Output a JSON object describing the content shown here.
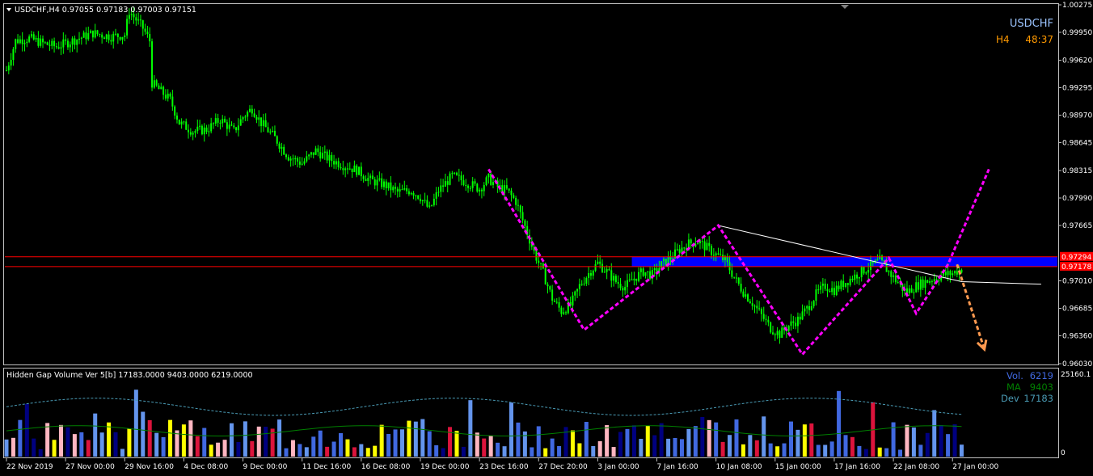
{
  "window": {
    "header_text": "USDCHF,H4  0.97055 0.97183 0.97003 0.97151",
    "symbol_label": "USDCHF",
    "timeframe_label": "H4",
    "countdown_label": "48:37"
  },
  "chart_data": {
    "type": "bar",
    "symbol": "USDCHF",
    "timeframe": "H4",
    "ohlc_last": {
      "open": 0.97055,
      "high": 0.97183,
      "low": 0.97003,
      "close": 0.97151
    },
    "ylim": [
      0.9603,
      1.00275
    ],
    "y_ticks": [
      "1.00275",
      "0.99950",
      "0.99620",
      "0.99295",
      "0.98970",
      "0.98645",
      "0.98315",
      "0.97990",
      "0.97665",
      "0.97010",
      "0.96685",
      "0.96360",
      "0.96030"
    ],
    "y_tick_values": [
      1.00275,
      0.9995,
      0.9962,
      0.99295,
      0.9897,
      0.98645,
      0.98315,
      0.9799,
      0.97665,
      0.9701,
      0.96685,
      0.9636,
      0.9603
    ],
    "price_labels": [
      "0.97294",
      "0.97178"
    ],
    "price_label_values": [
      0.97294,
      0.97178
    ],
    "x_ticks": [
      "22 Nov 2019",
      "27 Nov 00:00",
      "29 Nov 16:00",
      "4 Dec 08:00",
      "9 Dec 00:00",
      "11 Dec 16:00",
      "16 Dec 08:00",
      "19 Dec 00:00",
      "23 Dec 16:00",
      "27 Dec 20:00",
      "3 Jan 00:00",
      "7 Jan 16:00",
      "10 Jan 08:00",
      "15 Jan 00:00",
      "17 Jan 16:00",
      "22 Jan 08:00",
      "27 Jan 00:00"
    ],
    "x_tick_index": [
      0,
      26,
      52,
      78,
      104,
      130,
      156,
      182,
      208,
      234,
      260,
      286,
      312,
      338,
      364,
      390,
      416
    ],
    "bar_count": 421,
    "close_path": [
      [
        0,
        0.995
      ],
      [
        4,
        0.9985
      ],
      [
        10,
        0.9988
      ],
      [
        16,
        0.9982
      ],
      [
        22,
        0.9978
      ],
      [
        30,
        0.9986
      ],
      [
        38,
        0.9994
      ],
      [
        46,
        0.999
      ],
      [
        52,
        0.9992
      ],
      [
        54,
        1.002
      ],
      [
        60,
        1.0
      ],
      [
        63,
        0.9985
      ],
      [
        64,
        0.9935
      ],
      [
        68,
        0.9925
      ],
      [
        72,
        0.9915
      ],
      [
        76,
        0.9888
      ],
      [
        82,
        0.9878
      ],
      [
        88,
        0.988
      ],
      [
        94,
        0.9892
      ],
      [
        100,
        0.9878
      ],
      [
        104,
        0.9895
      ],
      [
        108,
        0.9905
      ],
      [
        112,
        0.9888
      ],
      [
        118,
        0.987
      ],
      [
        124,
        0.9848
      ],
      [
        130,
        0.984
      ],
      [
        136,
        0.9855
      ],
      [
        142,
        0.9845
      ],
      [
        148,
        0.9838
      ],
      [
        154,
        0.9832
      ],
      [
        160,
        0.982
      ],
      [
        166,
        0.9815
      ],
      [
        172,
        0.9806
      ],
      [
        178,
        0.9808
      ],
      [
        182,
        0.98
      ],
      [
        186,
        0.9785
      ],
      [
        190,
        0.9808
      ],
      [
        196,
        0.9825
      ],
      [
        202,
        0.9818
      ],
      [
        208,
        0.981
      ],
      [
        212,
        0.9822
      ],
      [
        216,
        0.9812
      ],
      [
        220,
        0.9808
      ],
      [
        224,
        0.9795
      ],
      [
        228,
        0.9765
      ],
      [
        232,
        0.9735
      ],
      [
        236,
        0.971
      ],
      [
        240,
        0.968
      ],
      [
        244,
        0.9665
      ],
      [
        248,
        0.9672
      ],
      [
        252,
        0.9695
      ],
      [
        256,
        0.971
      ],
      [
        260,
        0.9722
      ],
      [
        264,
        0.9712
      ],
      [
        268,
        0.97
      ],
      [
        272,
        0.9694
      ],
      [
        276,
        0.9704
      ],
      [
        280,
        0.9712
      ],
      [
        284,
        0.9708
      ],
      [
        288,
        0.972
      ],
      [
        292,
        0.9728
      ],
      [
        296,
        0.9738
      ],
      [
        300,
        0.9745
      ],
      [
        304,
        0.9748
      ],
      [
        308,
        0.974
      ],
      [
        312,
        0.9732
      ],
      [
        316,
        0.9725
      ],
      [
        320,
        0.9705
      ],
      [
        324,
        0.9688
      ],
      [
        328,
        0.9675
      ],
      [
        332,
        0.966
      ],
      [
        336,
        0.9645
      ],
      [
        340,
        0.9638
      ],
      [
        344,
        0.9648
      ],
      [
        348,
        0.9655
      ],
      [
        352,
        0.9668
      ],
      [
        356,
        0.9685
      ],
      [
        360,
        0.9695
      ],
      [
        364,
        0.969
      ],
      [
        368,
        0.9698
      ],
      [
        372,
        0.9705
      ],
      [
        376,
        0.9712
      ],
      [
        380,
        0.9718
      ],
      [
        384,
        0.9725
      ],
      [
        386,
        0.9718
      ],
      [
        390,
        0.9705
      ],
      [
        394,
        0.9692
      ],
      [
        396,
        0.9688
      ],
      [
        400,
        0.9695
      ],
      [
        404,
        0.97
      ],
      [
        408,
        0.9704
      ],
      [
        412,
        0.9708
      ],
      [
        416,
        0.971
      ],
      [
        420,
        0.97151
      ]
    ],
    "horizontal_lines": [
      0.97294,
      0.97178
    ],
    "zone": {
      "x_start": 275,
      "x_end": 420,
      "y_low": 0.97178,
      "y_high": 0.97294,
      "color": "#0000ff"
    },
    "trendline": [
      [
        313,
        0.97665
      ],
      [
        420,
        0.97
      ],
      [
        455,
        0.9697
      ]
    ],
    "pattern_zigzag": [
      [
        212,
        0.9833
      ],
      [
        254,
        0.9643
      ],
      [
        313,
        0.97665
      ],
      [
        350,
        0.9614
      ],
      [
        388,
        0.9728
      ],
      [
        400,
        0.96625
      ],
      [
        414,
        0.97204
      ],
      [
        432,
        0.9833
      ]
    ],
    "forecast_arrow": [
      [
        418,
        0.97204
      ],
      [
        430,
        0.962
      ]
    ],
    "colors": {
      "candle": "#00ff00",
      "zigzag": "#ff00ff",
      "arrow": "#ff9a50",
      "hline": "#ff0000",
      "label_bg": "#ff0000",
      "symbol": "#9bc4ff",
      "timeframe": "#ff9900"
    },
    "indicator": {
      "header": "Hidden Gap Volume Ver 5[b] 17183.0000 9403.0000 6219.0000",
      "vol_label": "Vol.",
      "vol_value": "6219",
      "ma_label": "MA",
      "ma_value": "9403",
      "dev_label": "Dev",
      "dev_value": "17183",
      "ylim": [
        0,
        25160.1
      ],
      "y_ticks": [
        "25160.1",
        "0"
      ],
      "y_tick_values": [
        25160.1,
        0
      ],
      "colors": {
        "vol": "#4169e1",
        "ma": "#008000",
        "dev": "#4a9bb5"
      }
    }
  }
}
